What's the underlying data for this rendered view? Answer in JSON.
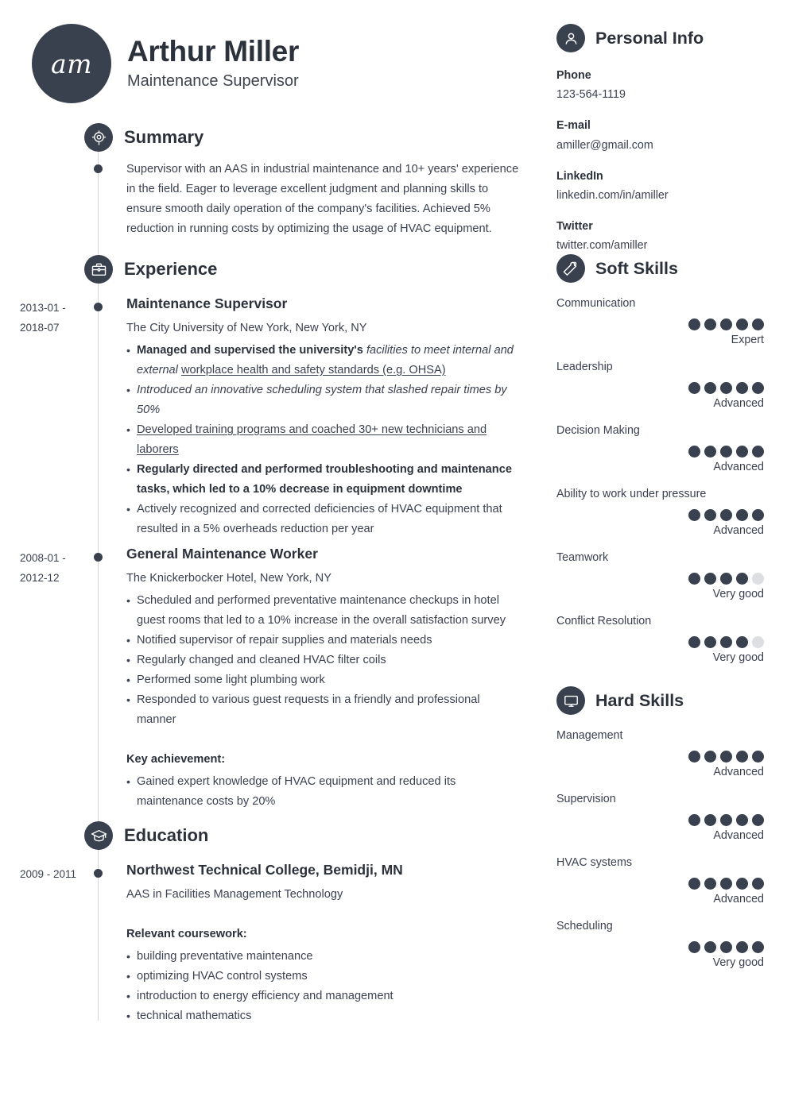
{
  "header": {
    "initials": "am",
    "name": "Arthur Miller",
    "job_title": "Maintenance Supervisor"
  },
  "sections": {
    "summary_title": "Summary",
    "experience_title": "Experience",
    "education_title": "Education",
    "personal_info_title": "Personal Info",
    "soft_skills_title": "Soft Skills",
    "hard_skills_title": "Hard Skills"
  },
  "summary": {
    "text": "Supervisor with an AAS in industrial maintenance and 10+ years' experience in the field. Eager to leverage excellent judgment and planning skills to ensure smooth daily operation of the company's facilities. Achieved 5% reduction in running costs by optimizing the usage of HVAC equipment."
  },
  "experience": [
    {
      "dates": "2013-01 - 2018-07",
      "title": "Maintenance Supervisor",
      "employer": "The City University of New York, New York, NY",
      "bullets_plain": [
        "Managed and supervised the university's facilities to meet internal and external workplace health and safety standards (e.g. OHSA)",
        "Introduced an innovative scheduling system that slashed repair times by 50%",
        "Developed training programs and coached 30+ new technicians and laborers",
        "Regularly directed and performed troubleshooting and maintenance tasks, which led to a 10% decrease in equipment downtime",
        "Actively recognized and corrected deficiencies of HVAC equipment that resulted in a 5% overheads reduction per year"
      ]
    },
    {
      "dates": "2008-01 - 2012-12",
      "title": "General Maintenance Worker",
      "employer": "The Knickerbocker Hotel, New York, NY",
      "bullets_plain": [
        "Scheduled and performed preventative maintenance checkups in hotel guest rooms that led to a 10% increase in the overall satisfaction survey",
        "Notified supervisor of repair supplies and materials needs",
        "Regularly changed and cleaned HVAC filter coils",
        "Performed some light plumbing work",
        "Responded to various guest requests in a friendly and professional manner"
      ],
      "key_achievement_label": "Key achievement:",
      "key_achievement_bullets": [
        "Gained expert knowledge of HVAC equipment and reduced its maintenance costs by 20%"
      ]
    }
  ],
  "education": [
    {
      "dates": "2009 - 2011",
      "title": "Northwest Technical College, Bemidji, MN",
      "degree": "AAS in Facilities Management Technology",
      "coursework_label": "Relevant coursework:",
      "coursework": [
        "building preventative maintenance",
        "optimizing HVAC control systems",
        "introduction to energy efficiency and management",
        "technical mathematics"
      ]
    }
  ],
  "personal_info": [
    {
      "label": "Phone",
      "value": "123-564-1119"
    },
    {
      "label": "E-mail",
      "value": "amiller@gmail.com"
    },
    {
      "label": "LinkedIn",
      "value": "linkedin.com/in/amiller"
    },
    {
      "label": "Twitter",
      "value": "twitter.com/amiller"
    }
  ],
  "soft_skills": [
    {
      "name": "Communication",
      "filled": 5,
      "total": 5,
      "level": "Expert"
    },
    {
      "name": "Leadership",
      "filled": 5,
      "total": 5,
      "level": "Advanced"
    },
    {
      "name": "Decision Making",
      "filled": 5,
      "total": 5,
      "level": "Advanced"
    },
    {
      "name": "Ability to work under pressure",
      "filled": 5,
      "total": 5,
      "level": "Advanced"
    },
    {
      "name": "Teamwork",
      "filled": 4,
      "total": 5,
      "level": "Very good"
    },
    {
      "name": "Conflict Resolution",
      "filled": 4,
      "total": 5,
      "level": "Very good"
    }
  ],
  "hard_skills": [
    {
      "name": "Management",
      "filled": 5,
      "total": 5,
      "level": "Advanced"
    },
    {
      "name": "Supervision",
      "filled": 5,
      "total": 5,
      "level": "Advanced"
    },
    {
      "name": "HVAC systems",
      "filled": 5,
      "total": 5,
      "level": "Advanced"
    },
    {
      "name": "Scheduling",
      "filled": 5,
      "total": 5,
      "level": "Very good"
    }
  ],
  "colors": {
    "accent_dark": "#39404e",
    "text": "#3a4150",
    "heading": "#2c323c",
    "dot_empty": "#dcdee1",
    "rule": "#d2d5da"
  }
}
